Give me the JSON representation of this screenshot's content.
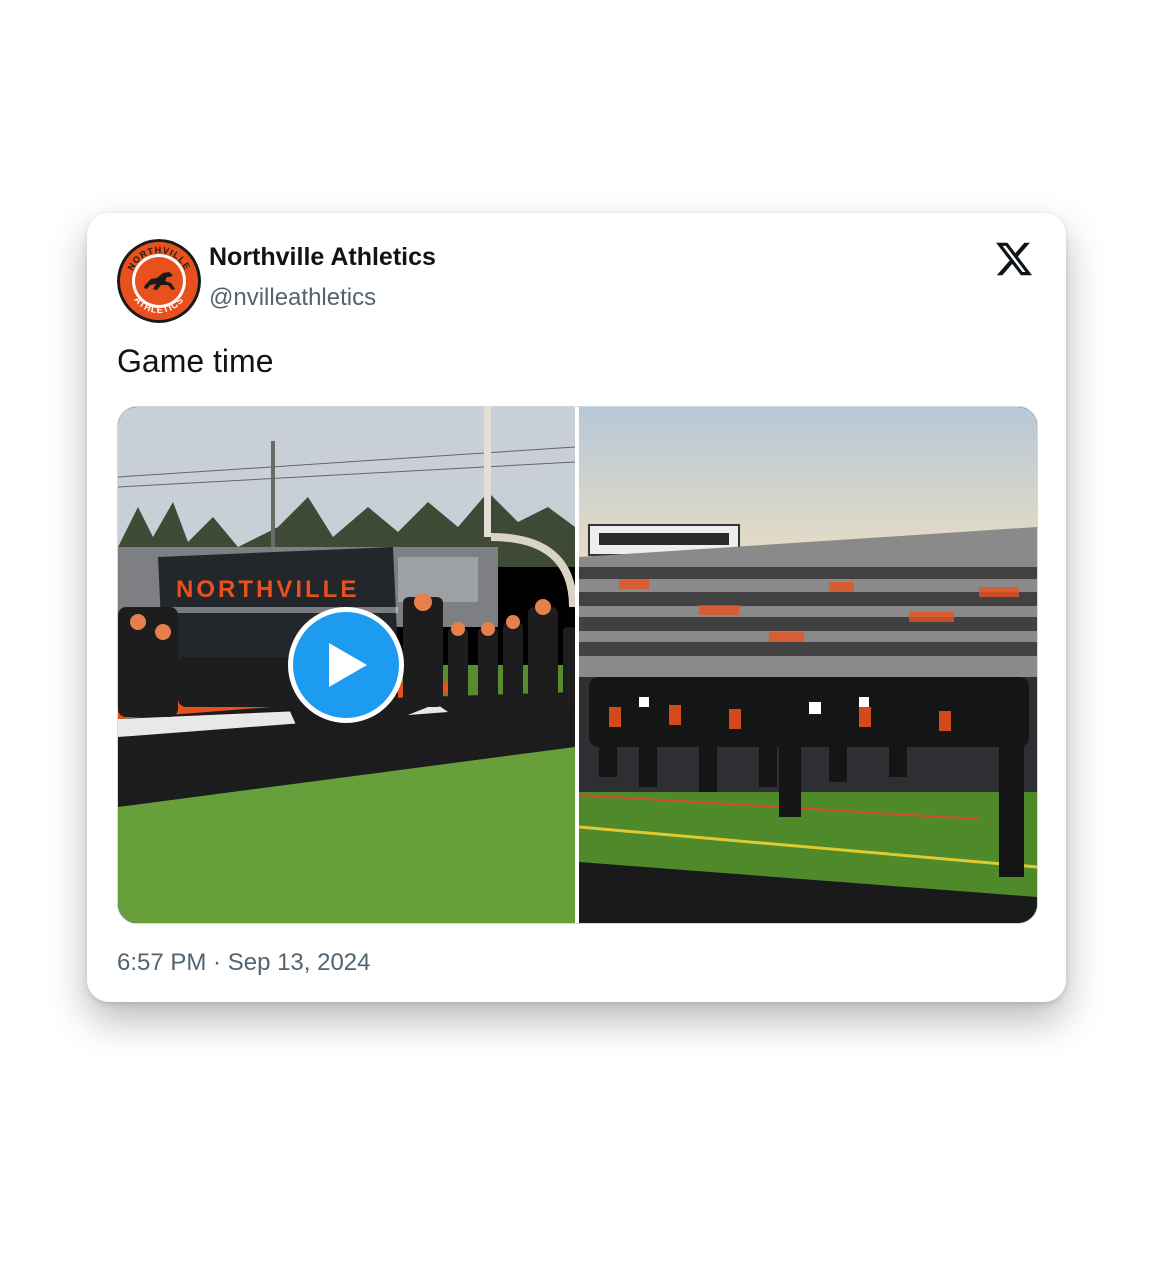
{
  "tweet": {
    "display_name": "Northville Athletics",
    "handle": "@nvilleathletics",
    "text": "Game time",
    "timestamp": "6:57 PM · Sep 13, 2024"
  },
  "avatar": {
    "top_text": "NORTHVILLE",
    "bottom_text": "ATHLETICS"
  },
  "media": {
    "banner_text": "NORTHVILLE",
    "items": [
      {
        "kind": "video",
        "icon": "play-icon"
      },
      {
        "kind": "photo"
      }
    ]
  },
  "icons": {
    "brand": "x-logo-icon",
    "play": "play-icon"
  },
  "colors": {
    "accent": "#1d9bf0",
    "brand_orange": "#e8511e",
    "text_primary": "#0f1419",
    "text_secondary": "#536471"
  }
}
